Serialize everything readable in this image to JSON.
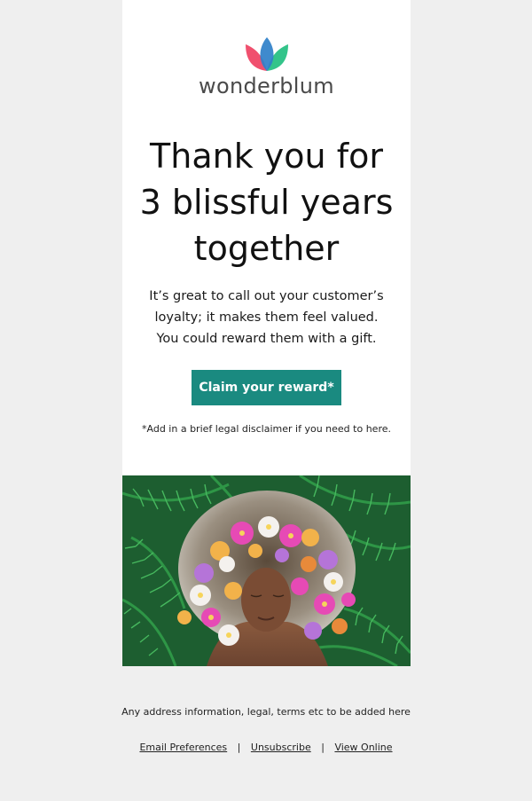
{
  "brand": {
    "name": "wonderblum",
    "logo_colors": [
      "#f0506e",
      "#2f80c9",
      "#33c48a"
    ]
  },
  "headline": {
    "line1": "Thank you for",
    "line2": "3 blissful years",
    "line3": "together"
  },
  "body": {
    "line1": "It’s great to call out your customer’s",
    "line2": "loyalty; it makes them feel valued.",
    "line3": "You could reward them with a gift."
  },
  "cta": {
    "label": "Claim your reward*",
    "color": "#1a8a80"
  },
  "disclaimer": "*Add in a brief legal disclaimer if you need to here.",
  "hero_image": {
    "icon": "woman-with-flower-crown-in-ferns-photo"
  },
  "footer": {
    "info": "Any address information, legal, terms etc to be added here",
    "links": {
      "email_preferences": "Email Preferences",
      "unsubscribe": "Unsubscribe",
      "view_online": "View Online",
      "separator": "|"
    }
  }
}
